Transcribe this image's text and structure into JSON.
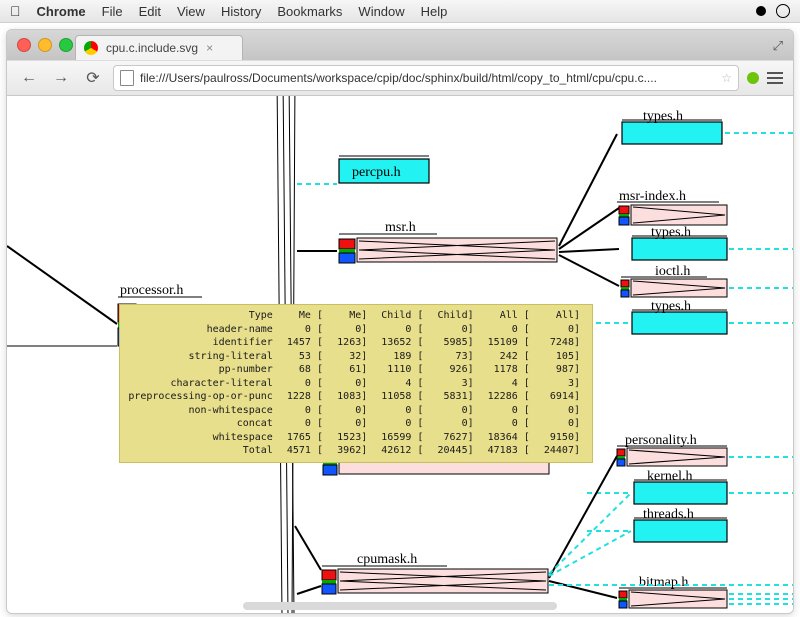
{
  "menubar": {
    "app": "Chrome",
    "items": [
      "File",
      "Edit",
      "View",
      "History",
      "Bookmarks",
      "Window",
      "Help"
    ]
  },
  "tab": {
    "title": "cpu.c.include.svg"
  },
  "omnibox": {
    "url": "file:///Users/paulross/Documents/workspace/cpip/doc/sphinx/build/html/copy_to_html/cpu/cpu.c...."
  },
  "nodes": {
    "processor": {
      "label": "processor.h"
    },
    "percpu": {
      "label": "percpu.h"
    },
    "msr": {
      "label": "msr.h"
    },
    "cpumask": {
      "label": "cpumask.h"
    },
    "types1": {
      "label": "types.h"
    },
    "msr_index": {
      "label": "msr-index.h"
    },
    "types2": {
      "label": "types.h"
    },
    "ioctl": {
      "label": "ioctl.h"
    },
    "types3": {
      "label": "types.h"
    },
    "personality": {
      "label": "personality.h"
    },
    "kernel": {
      "label": "kernel.h"
    },
    "threads": {
      "label": "threads.h"
    },
    "bitmap": {
      "label": "bitmap.h"
    }
  },
  "tooltip": {
    "header": {
      "c0": "Type",
      "c1": "Me [",
      "c2": "Me]",
      "c3": "Child [",
      "c4": "Child]",
      "c5": "All [",
      "c6": "All]"
    },
    "rows": [
      {
        "label": "header-name",
        "me_l": 0,
        "me_r": 0,
        "ch_l": 0,
        "ch_r": 0,
        "all_l": 0,
        "all_r": 0
      },
      {
        "label": "identifier",
        "me_l": 1457,
        "me_r": 1263,
        "ch_l": 13652,
        "ch_r": 5985,
        "all_l": 15109,
        "all_r": 7248
      },
      {
        "label": "string-literal",
        "me_l": 53,
        "me_r": 32,
        "ch_l": 189,
        "ch_r": 73,
        "all_l": 242,
        "all_r": 105
      },
      {
        "label": "pp-number",
        "me_l": 68,
        "me_r": 61,
        "ch_l": 1110,
        "ch_r": 926,
        "all_l": 1178,
        "all_r": 987
      },
      {
        "label": "character-literal",
        "me_l": 0,
        "me_r": 0,
        "ch_l": 4,
        "ch_r": 3,
        "all_l": 4,
        "all_r": 3
      },
      {
        "label": "preprocessing-op-or-punc",
        "me_l": 1228,
        "me_r": 1083,
        "ch_l": 11058,
        "ch_r": 5831,
        "all_l": 12286,
        "all_r": 6914
      },
      {
        "label": "non-whitespace",
        "me_l": 0,
        "me_r": 0,
        "ch_l": 0,
        "ch_r": 0,
        "all_l": 0,
        "all_r": 0
      },
      {
        "label": "concat",
        "me_l": 0,
        "me_r": 0,
        "ch_l": 0,
        "ch_r": 0,
        "all_l": 0,
        "all_r": 0
      },
      {
        "label": "whitespace",
        "me_l": 1765,
        "me_r": 1523,
        "ch_l": 16599,
        "ch_r": 7627,
        "all_l": 18364,
        "all_r": 9150
      },
      {
        "label": "Total",
        "me_l": 4571,
        "me_r": 3962,
        "ch_l": 42612,
        "ch_r": 20445,
        "all_l": 47183,
        "all_r": 24407
      }
    ]
  }
}
